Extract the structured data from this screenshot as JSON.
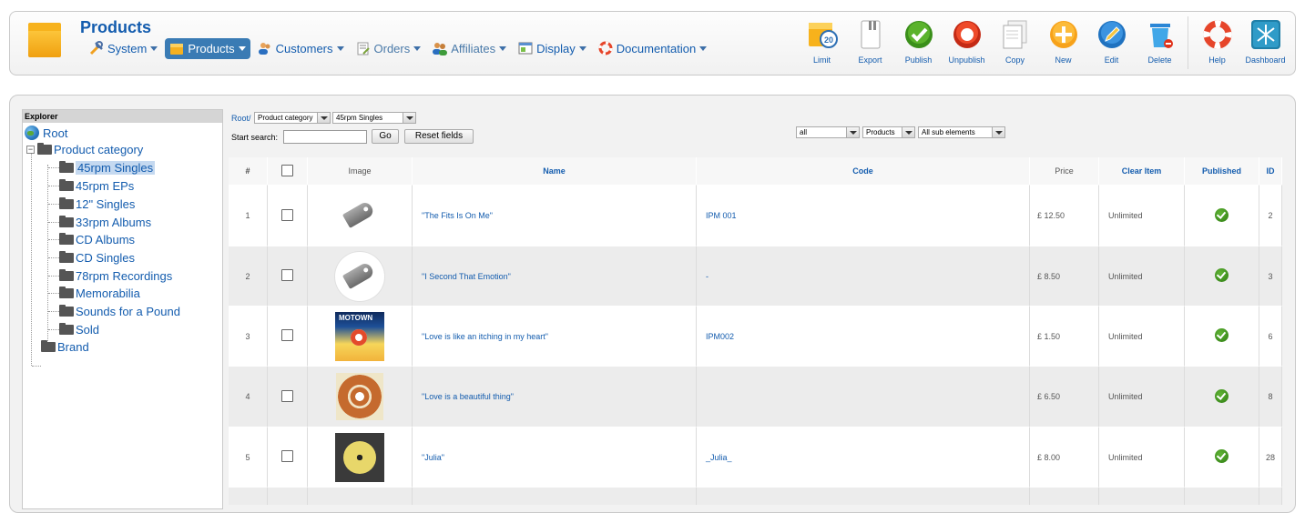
{
  "app": {
    "title": "Products"
  },
  "menu": [
    {
      "label": "System",
      "icon": "tools-icon",
      "state": "normal"
    },
    {
      "label": "Products",
      "icon": "box-icon",
      "state": "active"
    },
    {
      "label": "Customers",
      "icon": "customers-icon",
      "state": "normal"
    },
    {
      "label": "Orders",
      "icon": "orders-icon",
      "state": "dim"
    },
    {
      "label": "Affiliates",
      "icon": "affiliates-icon",
      "state": "dim"
    },
    {
      "label": "Display",
      "icon": "display-icon",
      "state": "normal"
    },
    {
      "label": "Documentation",
      "icon": "lifebuoy-icon",
      "state": "normal"
    }
  ],
  "toolbar": {
    "limit": "Limit",
    "export": "Export",
    "publish": "Publish",
    "unpublish": "Unpublish",
    "copy": "Copy",
    "new": "New",
    "edit": "Edit",
    "delete": "Delete",
    "help": "Help",
    "dashboard": "Dashboard",
    "limit_badge": "20"
  },
  "explorer": {
    "title": "Explorer",
    "root": "Root",
    "product_category": "Product category",
    "categories": [
      "45rpm Singles",
      "45rpm EPs",
      "12\" Singles",
      "33rpm Albums",
      "CD Albums",
      "CD Singles",
      "78rpm Recordings",
      "Memorabilia",
      "Sounds for a Pound",
      "Sold"
    ],
    "brand": "Brand",
    "selected": "45rpm Singles"
  },
  "filters": {
    "breadcrumb_root": "Root/",
    "category_type": "Product category",
    "category_value": "45rpm Singles",
    "search_label": "Start search:",
    "search_value": "",
    "go": "Go",
    "reset": "Reset fields",
    "scope": "all",
    "element_type": "Products",
    "depth": "All sub elements"
  },
  "table": {
    "headers": {
      "num": "#",
      "image": "Image",
      "name": "Name",
      "code": "Code",
      "price": "Price",
      "clear": "Clear Item",
      "published": "Published",
      "id": "ID"
    },
    "rows": [
      {
        "num": "1",
        "thumb": "tag",
        "name": "\"The Fits Is On Me\"",
        "code": "IPM 001",
        "price": "£ 12.50",
        "clear": "Unlimited",
        "published": true,
        "id": "2"
      },
      {
        "num": "2",
        "thumb": "tag-circle",
        "name": "\"I Second That Emotion\"",
        "code": "-",
        "price": "£ 8.50",
        "clear": "Unlimited",
        "published": true,
        "id": "3"
      },
      {
        "num": "3",
        "thumb": "motown",
        "name": "\"Love is like an itching in my heart\"",
        "code": "IPM002",
        "price": "£ 1.50",
        "clear": "Unlimited",
        "published": true,
        "id": "6"
      },
      {
        "num": "4",
        "thumb": "record-orange",
        "name": "\"Love is a beautiful thing\"",
        "code": "",
        "price": "£ 6.50",
        "clear": "Unlimited",
        "published": true,
        "id": "8"
      },
      {
        "num": "5",
        "thumb": "chess",
        "name": "\"Julia\"",
        "code": "_Julia_",
        "price": "£ 8.00",
        "clear": "Unlimited",
        "published": true,
        "id": "28"
      }
    ]
  },
  "colors": {
    "link": "#135cae",
    "active_menu": "#3a7bb4",
    "publish_green": "#3a8f1a",
    "unpublish_red": "#e0321b",
    "new_orange": "#f7a21a",
    "edit_blue": "#2a86d6",
    "dashboard_teal": "#1f7fa8"
  }
}
